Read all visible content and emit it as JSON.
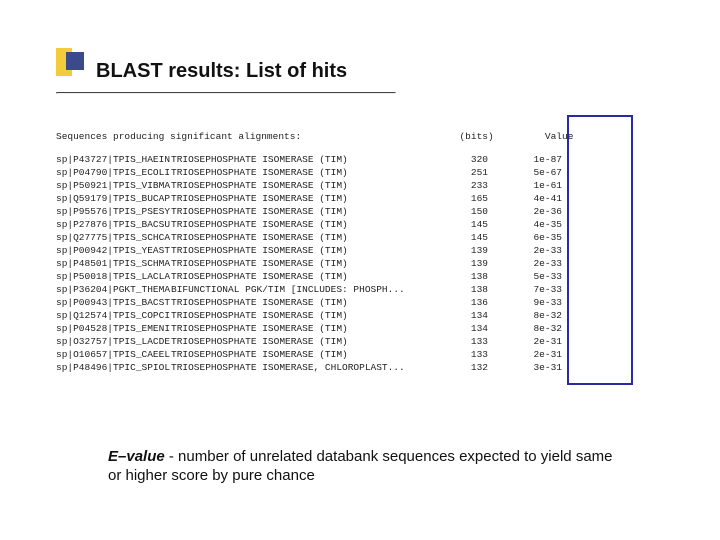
{
  "title": "BLAST results: List of hits",
  "header": {
    "seq_label": "Sequences producing significant alignments:",
    "bits_label": "(bits)",
    "value_label": "Value"
  },
  "rows": [
    {
      "id": "sp|P43727|TPIS_HAEIN",
      "desc": "TRIOSEPHOSPHATE ISOMERASE (TIM)",
      "bits": 320,
      "evalue": "1e-87"
    },
    {
      "id": "sp|P04790|TPIS_ECOLI",
      "desc": "TRIOSEPHOSPHATE ISOMERASE (TIM)",
      "bits": 251,
      "evalue": "5e-67"
    },
    {
      "id": "sp|P50921|TPIS_VIBMA",
      "desc": "TRIOSEPHOSPHATE ISOMERASE (TIM)",
      "bits": 233,
      "evalue": "1e-61"
    },
    {
      "id": "sp|Q59179|TPIS_BUCAP",
      "desc": "TRIOSEPHOSPHATE ISOMERASE (TIM)",
      "bits": 165,
      "evalue": "4e-41"
    },
    {
      "id": "sp|P95576|TPIS_PSESY",
      "desc": "TRIOSEPHOSPHATE ISOMERASE (TIM)",
      "bits": 150,
      "evalue": "2e-36"
    },
    {
      "id": "sp|P27876|TPIS_BACSU",
      "desc": "TRIOSEPHOSPHATE ISOMERASE (TIM)",
      "bits": 145,
      "evalue": "4e-35"
    },
    {
      "id": "sp|Q27775|TPIS_SCHCA",
      "desc": "TRIOSEPHOSPHATE ISOMERASE (TIM)",
      "bits": 145,
      "evalue": "6e-35"
    },
    {
      "id": "sp|P00942|TPIS_YEAST",
      "desc": "TRIOSEPHOSPHATE ISOMERASE (TIM)",
      "bits": 139,
      "evalue": "2e-33"
    },
    {
      "id": "sp|P48501|TPIS_SCHMA",
      "desc": "TRIOSEPHOSPHATE ISOMERASE (TIM)",
      "bits": 139,
      "evalue": "2e-33"
    },
    {
      "id": "sp|P50018|TPIS_LACLA",
      "desc": "TRIOSEPHOSPHATE ISOMERASE (TIM)",
      "bits": 138,
      "evalue": "5e-33"
    },
    {
      "id": "sp|P36204|PGKT_THEMA",
      "desc": "BIFUNCTIONAL PGK/TIM [INCLUDES: PHOSPH...",
      "bits": 138,
      "evalue": "7e-33"
    },
    {
      "id": "sp|P00943|TPIS_BACST",
      "desc": "TRIOSEPHOSPHATE ISOMERASE (TIM)",
      "bits": 136,
      "evalue": "9e-33"
    },
    {
      "id": "sp|Q12574|TPIS_COPCI",
      "desc": "TRIOSEPHOSPHATE ISOMERASE (TIM)",
      "bits": 134,
      "evalue": "8e-32"
    },
    {
      "id": "sp|P04528|TPIS_EMENI",
      "desc": "TRIOSEPHOSPHATE ISOMERASE (TIM)",
      "bits": 134,
      "evalue": "8e-32"
    },
    {
      "id": "sp|O32757|TPIS_LACDE",
      "desc": "TRIOSEPHOSPHATE ISOMERASE (TIM)",
      "bits": 133,
      "evalue": "2e-31"
    },
    {
      "id": "sp|O10657|TPIS_CAEEL",
      "desc": "TRIOSEPHOSPHATE ISOMERASE (TIM)",
      "bits": 133,
      "evalue": "2e-31"
    },
    {
      "id": "sp|P48496|TPIC_SPIOL",
      "desc": "TRIOSEPHOSPHATE ISOMERASE, CHLOROPLAST...",
      "bits": 132,
      "evalue": "3e-31"
    }
  ],
  "footnote": {
    "term": "E–value",
    "rest": " - number of unrelated databank sequences expected to yield same or higher score by pure chance"
  }
}
